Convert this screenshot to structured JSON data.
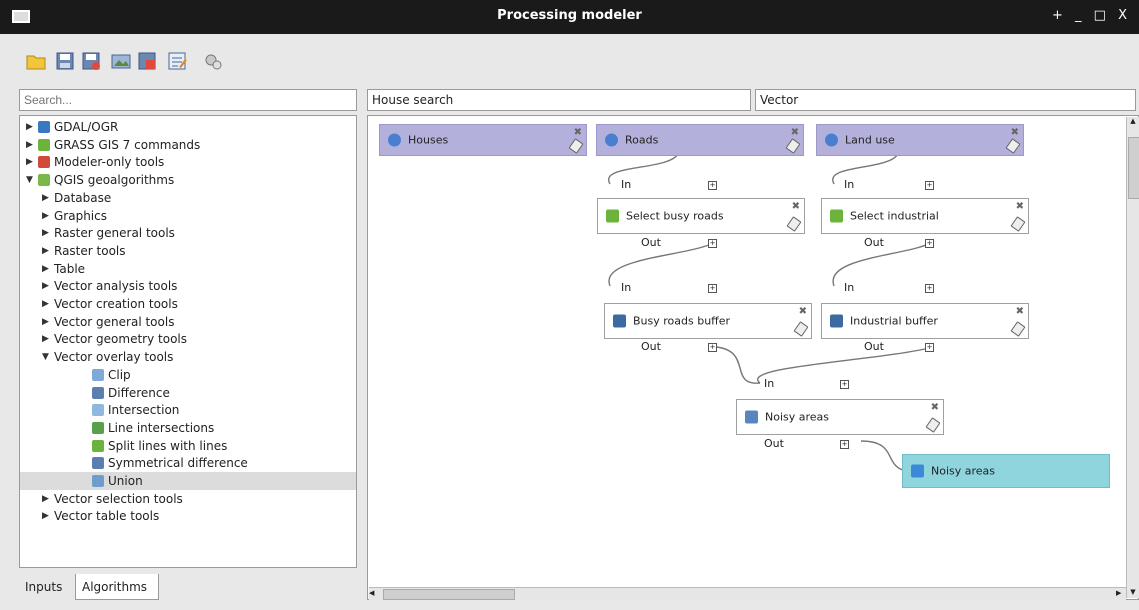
{
  "window": {
    "title": "Processing modeler",
    "controls": "+ _ □ X"
  },
  "toolbar": {
    "icons": [
      "open-model-icon",
      "save-icon",
      "save-as-icon",
      "export-image-icon",
      "export-python-icon",
      "edit-help-icon",
      "run-model-icon"
    ]
  },
  "search": {
    "placeholder": "Search..."
  },
  "model": {
    "name": "House search",
    "group": "Vector"
  },
  "tree": [
    {
      "label": "GDAL/OGR",
      "level": 0,
      "arrow": "▶",
      "icon": "gdal-icon"
    },
    {
      "label": "GRASS GIS 7 commands",
      "level": 0,
      "arrow": "▶",
      "icon": "grass-icon"
    },
    {
      "label": "Modeler-only tools",
      "level": 0,
      "arrow": "▶",
      "icon": "modeler-icon"
    },
    {
      "label": "QGIS geoalgorithms",
      "level": 0,
      "arrow": "▼",
      "icon": "qgis-icon"
    },
    {
      "label": "Database",
      "level": 1,
      "arrow": "▶"
    },
    {
      "label": "Graphics",
      "level": 1,
      "arrow": "▶"
    },
    {
      "label": "Raster general tools",
      "level": 1,
      "arrow": "▶"
    },
    {
      "label": "Raster tools",
      "level": 1,
      "arrow": "▶"
    },
    {
      "label": "Table",
      "level": 1,
      "arrow": "▶"
    },
    {
      "label": "Vector analysis tools",
      "level": 1,
      "arrow": "▶"
    },
    {
      "label": "Vector creation tools",
      "level": 1,
      "arrow": "▶"
    },
    {
      "label": "Vector general tools",
      "level": 1,
      "arrow": "▶"
    },
    {
      "label": "Vector geometry tools",
      "level": 1,
      "arrow": "▶"
    },
    {
      "label": "Vector overlay tools",
      "level": 1,
      "arrow": "▼"
    },
    {
      "label": "Clip",
      "level": 2,
      "icon": "clip-icon"
    },
    {
      "label": "Difference",
      "level": 2,
      "icon": "difference-icon"
    },
    {
      "label": "Intersection",
      "level": 2,
      "icon": "intersection-icon"
    },
    {
      "label": "Line intersections",
      "level": 2,
      "icon": "line-intersections-icon"
    },
    {
      "label": "Split lines with lines",
      "level": 2,
      "icon": "split-lines-icon"
    },
    {
      "label": "Symmetrical difference",
      "level": 2,
      "icon": "symmetrical-difference-icon"
    },
    {
      "label": "Union",
      "level": 2,
      "icon": "union-icon",
      "selected": true
    },
    {
      "label": "Vector selection tools",
      "level": 1,
      "arrow": "▶"
    },
    {
      "label": "Vector table tools",
      "level": 1,
      "arrow": "▶"
    }
  ],
  "tabs": {
    "inputs": "Inputs",
    "algorithms": "Algorithms"
  },
  "nodes": {
    "houses": "Houses",
    "roads": "Roads",
    "land_use": "Land use",
    "select_busy_roads": "Select busy roads",
    "select_industrial": "Select industrial",
    "busy_roads_buffer": "Busy roads buffer",
    "industrial_buffer": "Industrial buffer",
    "noisy_areas": "Noisy areas",
    "noisy_areas_output": "Noisy areas"
  },
  "ports": {
    "in": "In",
    "out": "Out"
  },
  "colors": {
    "input_node": "#b4b0dc",
    "output_node": "#8fd5de",
    "titlebar": "#1a1a1a"
  }
}
